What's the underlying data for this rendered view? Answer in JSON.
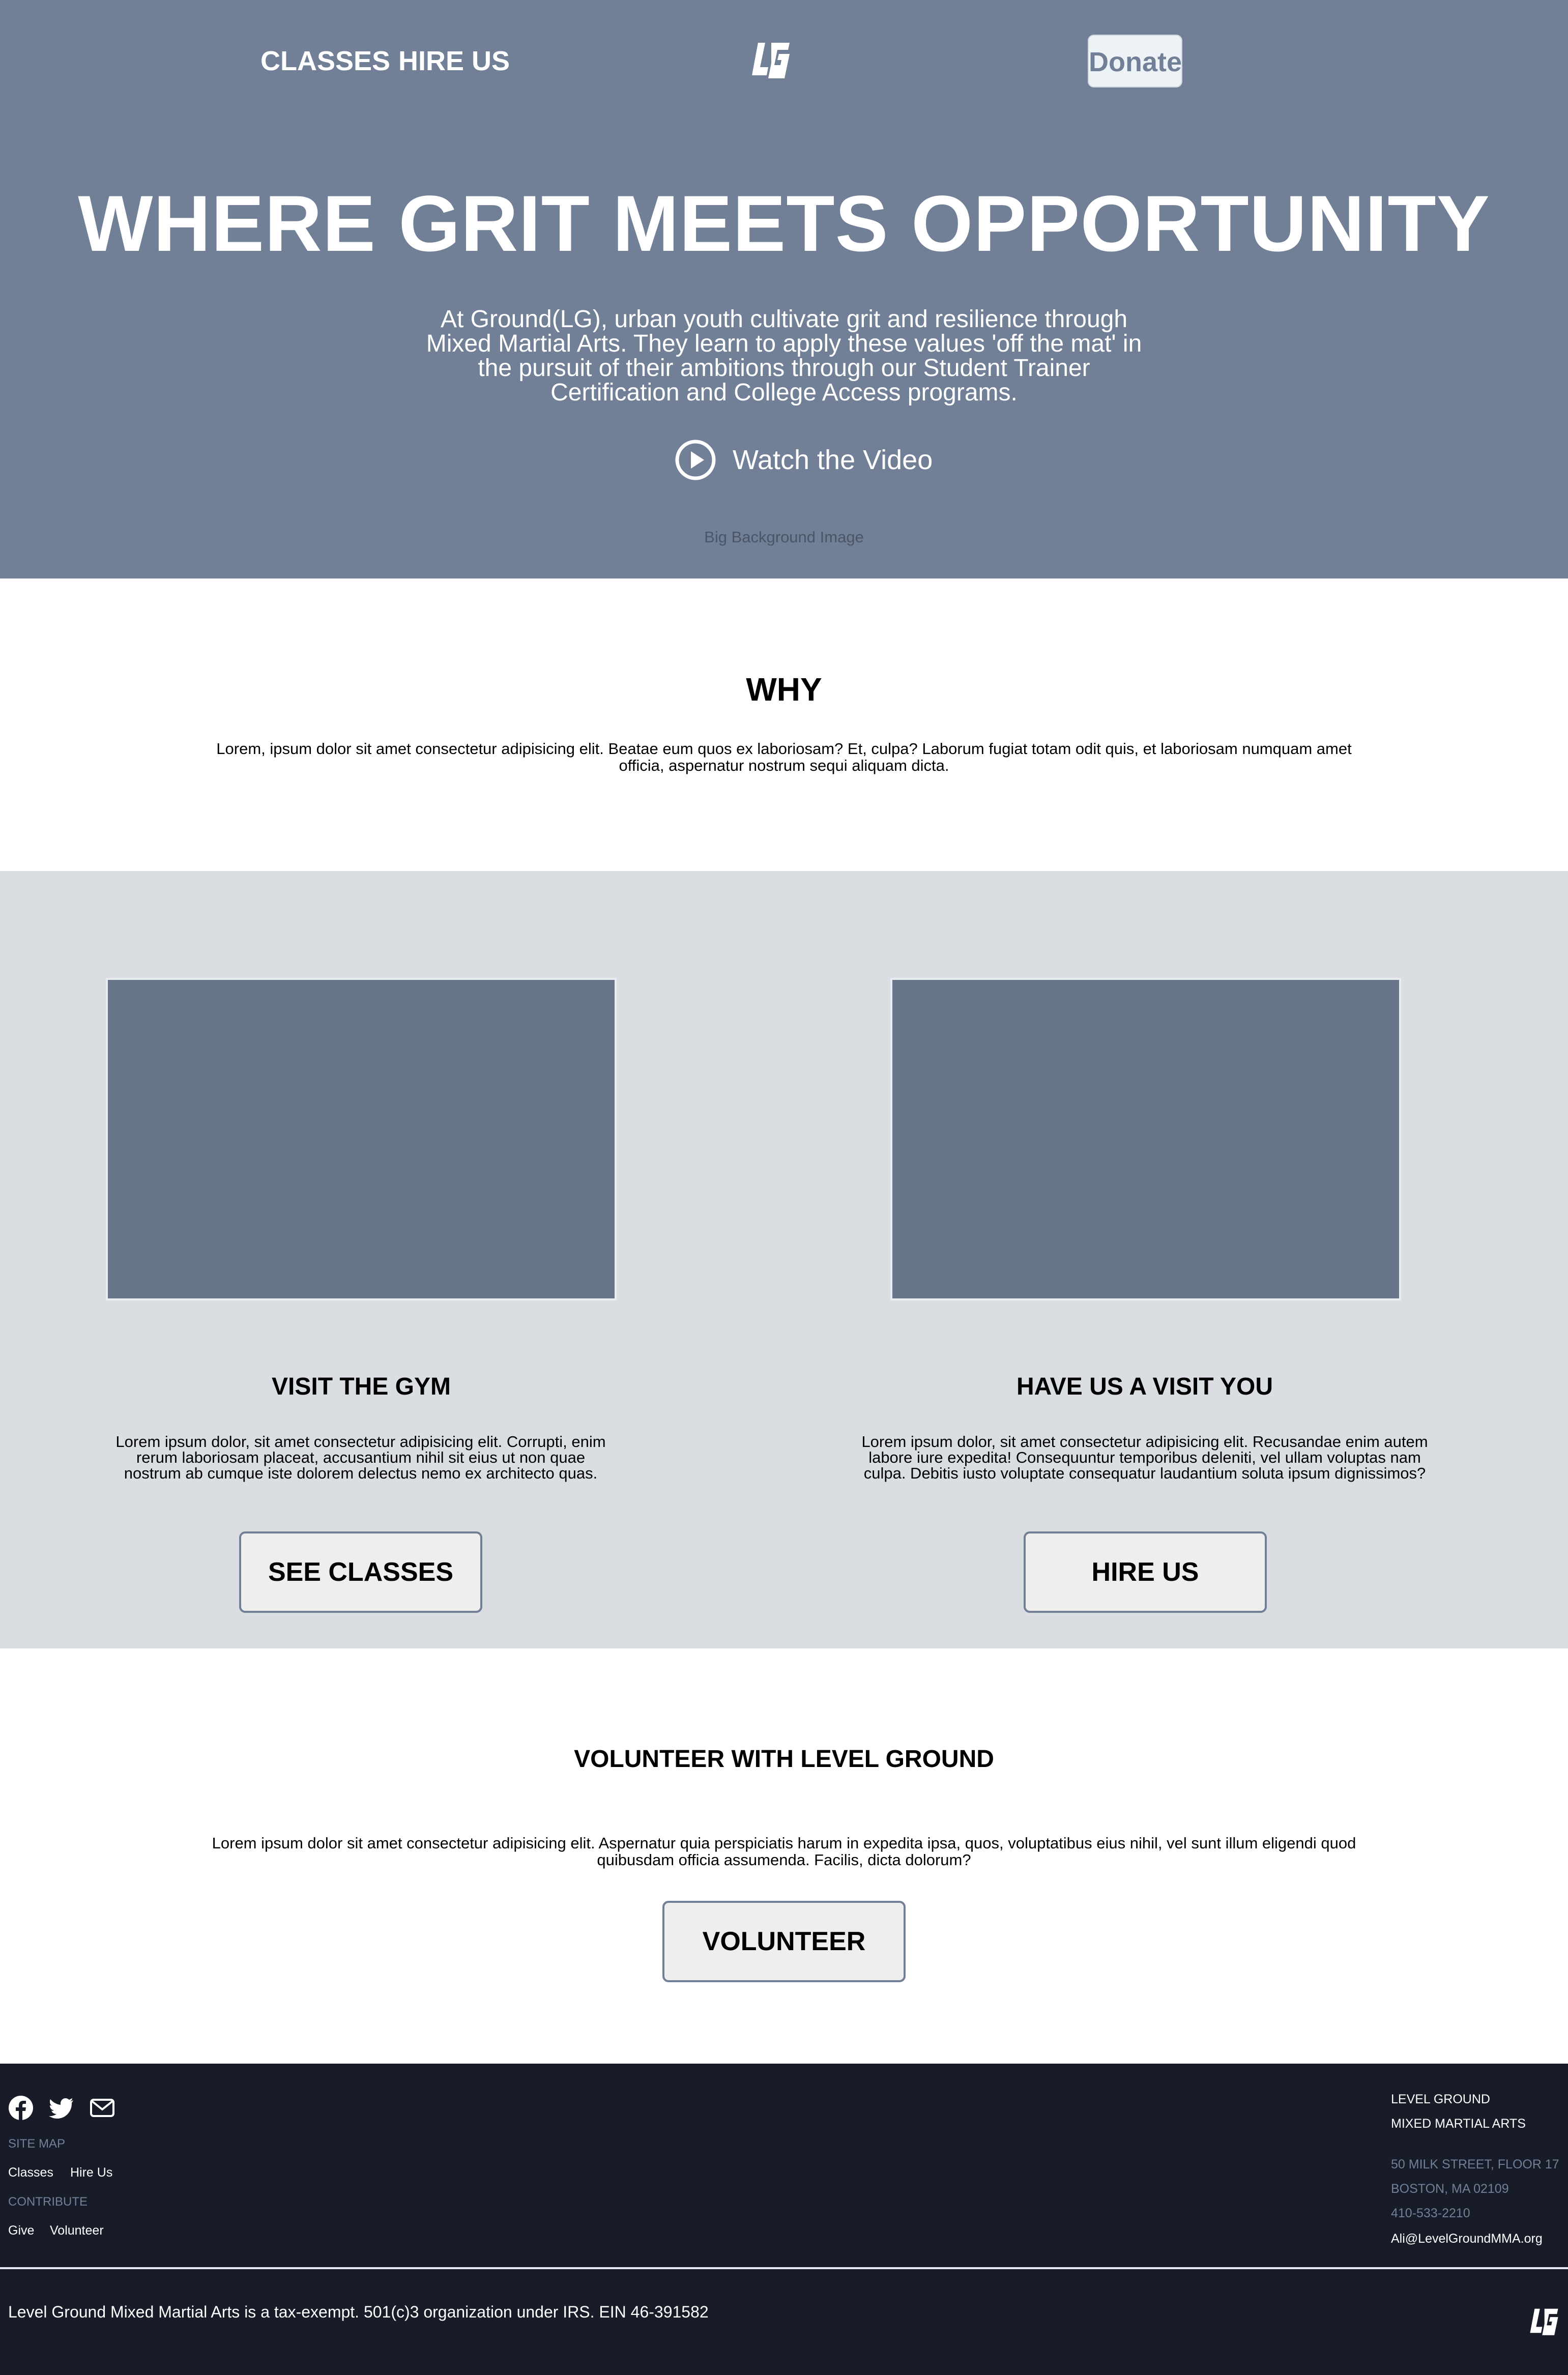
{
  "nav": {
    "links": [
      "CLASSES",
      "HIRE US"
    ],
    "logo_text": "LG",
    "donate_label": "Donate"
  },
  "hero": {
    "title": "WHERE GRIT MEETS OPPORTUNITY",
    "description": "At Ground(LG), urban youth cultivate grit and resilience through Mixed Martial Arts. They learn to apply these values 'off the mat' in the pursuit of their ambitions through our Student Trainer Certification and College Access programs.",
    "watch_label": "Watch the Video",
    "watch_icon": "play-circle-icon",
    "background_label": "Big Background Image"
  },
  "why": {
    "title": "WHY",
    "text": "Lorem, ipsum dolor sit amet consectetur adipisicing elit. Beatae eum quos ex laboriosam? Et, culpa? Laborum fugiat totam odit quis, et laboriosam numquam amet officia, aspernatur nostrum sequi aliquam dicta."
  },
  "cards": [
    {
      "title": "VISIT THE GYM",
      "text": "Lorem ipsum dolor, sit amet consectetur adipisicing elit. Corrupti, enim rerum laboriosam placeat, accusantium nihil sit eius ut non quae nostrum ab cumque iste dolorem delectus nemo ex architecto quas.",
      "button": "SEE CLASSES"
    },
    {
      "title": "HAVE US A VISIT YOU",
      "text": "Lorem ipsum dolor, sit amet consectetur adipisicing elit. Recusandae enim autem labore iure expedita! Consequuntur temporibus deleniti, vel ullam voluptas nam culpa. Debitis iusto voluptate consequatur laudantium soluta ipsum dignissimos?",
      "button": "HIRE US"
    }
  ],
  "volunteer": {
    "title": "VOLUNTEER WITH LEVEL GROUND",
    "text": "Lorem ipsum dolor sit amet consectetur adipisicing elit. Aspernatur quia perspiciatis harum in expedita ipsa, quos, voluptatibus eius nihil, vel sunt illum eligendi quod quibusdam officia assumenda. Facilis, dicta dolorum?",
    "button": "VOLUNTEER"
  },
  "footer": {
    "social_icons": [
      "facebook-icon",
      "twitter-icon",
      "envelope-icon"
    ],
    "site_map_heading": "SITE MAP",
    "site_map_links": [
      "Classes",
      "Hire Us"
    ],
    "contribute_heading": "CONTRIBUTE",
    "contribute_links": [
      "Give",
      "Volunteer"
    ],
    "org_name_line1": "LEVEL GROUND",
    "org_name_line2": "MIXED MARTIAL ARTS",
    "address_line1": "50 MILK STREET, FLOOR 17",
    "address_line2": "BOSTON, MA 02109",
    "phone": "410-533-2210",
    "email": "Ali@LevelGroundMMA.org",
    "legal": "Level Ground Mixed Martial Arts is a tax-exempt. 501(c)3 organization under IRS. EIN 46-391582"
  },
  "colors": {
    "hero_bg": "#718096",
    "gray_section_bg": "#dadde1",
    "placeholder_bg": "#667589",
    "footer_bg": "#171c28",
    "muted_text": "#718096"
  }
}
